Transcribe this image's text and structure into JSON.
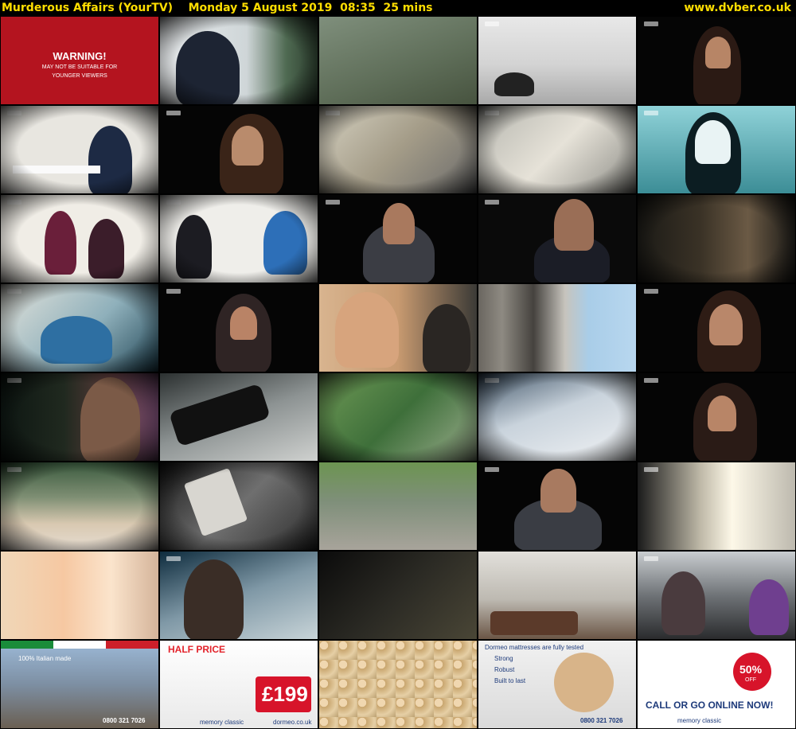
{
  "header": {
    "title": "Murderous Affairs (YourTV)    Monday 5 August 2019  08:35  25 mins",
    "site": "www.dvber.co.uk"
  },
  "colors": {
    "header_text": "#ffde00",
    "warning_bg": "#b4141f"
  },
  "warning": {
    "line1": "WARNING!",
    "line2": "MAY NOT BE SUITABLE FOR",
    "line3": "YOUNGER VIEWERS"
  },
  "ads": {
    "italian_made": "100% Italian made",
    "phone": "0800 321 7026",
    "half_price": "HALF PRICE",
    "price": "£199",
    "brand": "dormeo",
    "memory_classic": "memory classic",
    "site": "dormeo.co.uk",
    "tested": "Dormeo mattresses are fully tested",
    "strong": "Strong",
    "robust": "Robust",
    "built": "Built to last",
    "promo": "50%",
    "promo_off": "OFF",
    "call": "CALL OR GO ONLINE NOW!"
  }
}
